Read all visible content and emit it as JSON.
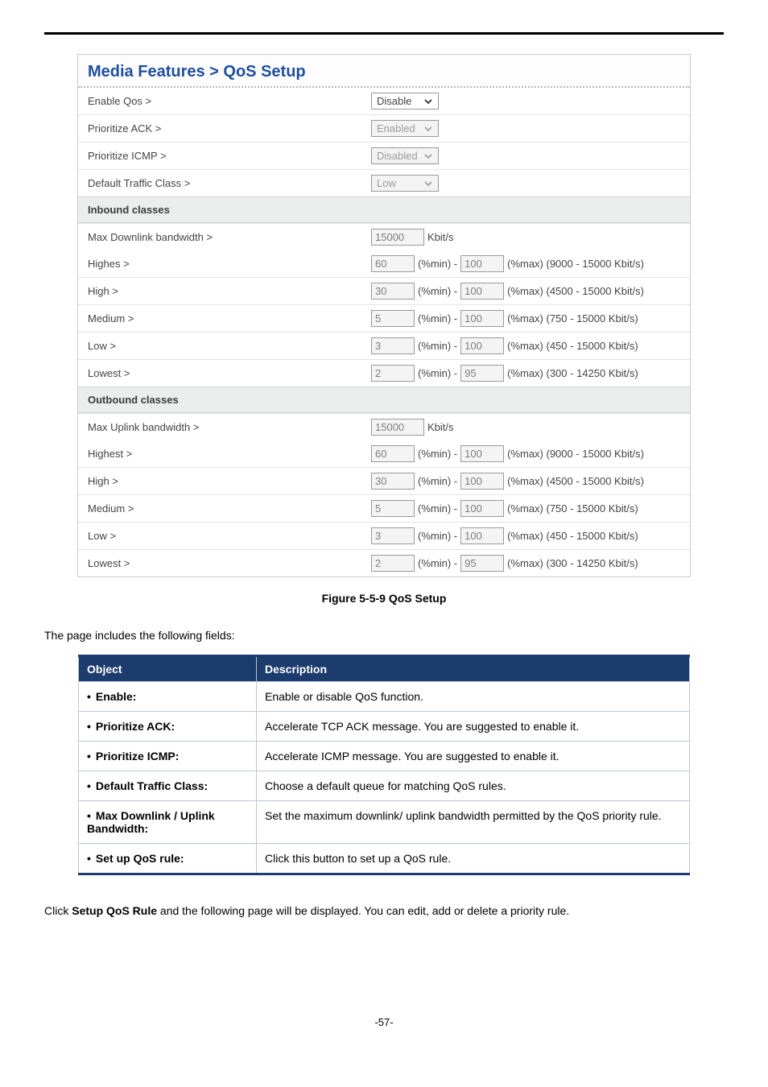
{
  "page_number": "-57-",
  "panel": {
    "title": "Media Features > QoS Setup",
    "rows_top": [
      {
        "label": "Enable Qos >",
        "value": "Disable",
        "disabled": false
      },
      {
        "label": "Prioritize ACK >",
        "value": "Enabled",
        "disabled": true
      },
      {
        "label": "Prioritize ICMP >",
        "value": "Disabled",
        "disabled": true
      },
      {
        "label": "Default Traffic Class >",
        "value": "Low",
        "disabled": true
      }
    ],
    "inbound": {
      "header": "Inbound classes",
      "bandwidth": {
        "label": "Max Downlink bandwidth >",
        "value": "15000",
        "unit": "Kbit/s"
      },
      "classes": [
        {
          "label": "Highes >",
          "min": "60",
          "max": "100",
          "range": "(9000 -  15000 Kbit/s)"
        },
        {
          "label": "High >",
          "min": "30",
          "max": "100",
          "range": "(4500 -  15000 Kbit/s)"
        },
        {
          "label": "Medium >",
          "min": "5",
          "max": "100",
          "range": "(750 -  15000 Kbit/s)"
        },
        {
          "label": "Low >",
          "min": "3",
          "max": "100",
          "range": "(450 -  15000 Kbit/s)"
        },
        {
          "label": "Lowest >",
          "min": "2",
          "max": "95",
          "range": "(300 -  14250 Kbit/s)"
        }
      ]
    },
    "outbound": {
      "header": "Outbound classes",
      "bandwidth": {
        "label": "Max Uplink bandwidth >",
        "value": "15000",
        "unit": "Kbit/s"
      },
      "classes": [
        {
          "label": "Highest >",
          "min": "60",
          "max": "100",
          "range": "(9000 -  15000 Kbit/s)"
        },
        {
          "label": "High >",
          "min": "30",
          "max": "100",
          "range": "(4500 -  15000 Kbit/s)"
        },
        {
          "label": "Medium >",
          "min": "5",
          "max": "100",
          "range": "(750 -  15000 Kbit/s)"
        },
        {
          "label": "Low >",
          "min": "3",
          "max": "100",
          "range": "(450 -  15000 Kbit/s)"
        },
        {
          "label": "Lowest >",
          "min": "2",
          "max": "95",
          "range": "(300 -  14250 Kbit/s)"
        }
      ]
    },
    "labels": {
      "pctmin": "(%min) -",
      "pctmax": "(%max)"
    }
  },
  "figure_caption": "Figure 5-5-9 QoS Setup",
  "intro_text": "The page includes the following fields:",
  "desc_table": {
    "headers": {
      "object": "Object",
      "description": "Description"
    },
    "rows": [
      {
        "object": "Enable:",
        "description": "Enable or disable QoS function."
      },
      {
        "object": "Prioritize ACK:",
        "description": "Accelerate TCP ACK message. You are suggested to enable it."
      },
      {
        "object": "Prioritize ICMP:",
        "description": "Accelerate ICMP message. You are suggested to enable it."
      },
      {
        "object": "Default Traffic Class:",
        "description": "Choose a default queue for matching QoS rules."
      },
      {
        "object": "Max Downlink / Uplink Bandwidth:",
        "description": "Set the maximum downlink/ uplink bandwidth permitted by the QoS priority rule."
      },
      {
        "object": "Set up QoS rule:",
        "description": "Click this button to set up a QoS rule."
      }
    ]
  },
  "closing_prefix": "Click ",
  "closing_bold": "Setup QoS Rule",
  "closing_suffix": " and the following page will be displayed. You can edit, add or delete a priority rule."
}
